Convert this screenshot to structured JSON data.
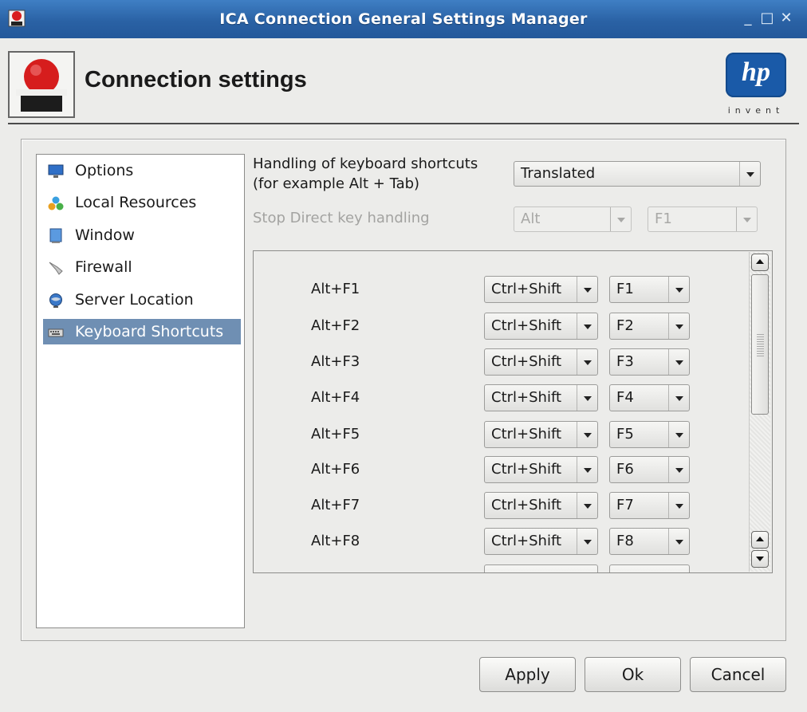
{
  "window": {
    "title": "ICA Connection General Settings Manager",
    "controls": [
      "_",
      "□",
      "✕"
    ]
  },
  "header": {
    "heading": "Connection settings",
    "logo_text": "hp",
    "logo_tagline": "invent"
  },
  "sidebar": {
    "items": [
      {
        "label": "Options",
        "icon": "monitor-icon",
        "selected": false
      },
      {
        "label": "Local Resources",
        "icon": "resources-icon",
        "selected": false
      },
      {
        "label": "Window",
        "icon": "window-icon",
        "selected": false
      },
      {
        "label": "Firewall",
        "icon": "firewall-icon",
        "selected": false
      },
      {
        "label": "Server Location",
        "icon": "globe-icon",
        "selected": false
      },
      {
        "label": "Keyboard Shortcuts",
        "icon": "keyboard-icon",
        "selected": true
      }
    ]
  },
  "form": {
    "handling_label_line1": "Handling of keyboard shortcuts",
    "handling_label_line2": "(for example Alt + Tab)",
    "handling_value": "Translated",
    "stop_label": "Stop Direct key handling",
    "stop_modifier": "Alt",
    "stop_key": "F1"
  },
  "shortcuts": [
    {
      "label": "Alt+F1",
      "modifier": "Ctrl+Shift",
      "key": "F1"
    },
    {
      "label": "Alt+F2",
      "modifier": "Ctrl+Shift",
      "key": "F2"
    },
    {
      "label": "Alt+F3",
      "modifier": "Ctrl+Shift",
      "key": "F3"
    },
    {
      "label": "Alt+F4",
      "modifier": "Ctrl+Shift",
      "key": "F4"
    },
    {
      "label": "Alt+F5",
      "modifier": "Ctrl+Shift",
      "key": "F5"
    },
    {
      "label": "Alt+F6",
      "modifier": "Ctrl+Shift",
      "key": "F6"
    },
    {
      "label": "Alt+F7",
      "modifier": "Ctrl+Shift",
      "key": "F7"
    },
    {
      "label": "Alt+F8",
      "modifier": "Ctrl+Shift",
      "key": "F8"
    }
  ],
  "buttons": {
    "apply": "Apply",
    "ok": "Ok",
    "cancel": "Cancel"
  },
  "colors": {
    "titlebar": "#2a62a5",
    "selection": "#6f8fb3",
    "hp_blue": "#1a5aa8"
  }
}
